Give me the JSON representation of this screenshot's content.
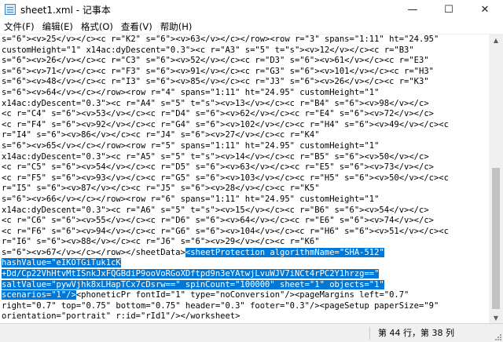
{
  "window": {
    "title": "sheet1.xml - 记事本",
    "icon": "notepad-icon",
    "controls": {
      "minimize": "—",
      "maximize": "☐",
      "close": "✕"
    }
  },
  "menu": {
    "items": [
      {
        "label": "文件(F)"
      },
      {
        "label": "编辑(E)"
      },
      {
        "label": "格式(O)"
      },
      {
        "label": "查看(V)"
      },
      {
        "label": "帮助(H)"
      }
    ]
  },
  "editor": {
    "lines": [
      {
        "text": "s=\"6\"><v>25</v></c><c r=\"K2\" s=\"6\"><v>63</v></c></row><row r=\"3\" spans=\"1:11\" ht=\"24.95\""
      },
      {
        "text": "customHeight=\"1\" x14ac:dyDescent=\"0.3\"><c r=\"A3\" s=\"5\" t=\"s\"><v>12</v></c><c r=\"B3\""
      },
      {
        "text": "s=\"6\"><v>26</v></c><c r=\"C3\" s=\"6\"><v>52</v></c><c r=\"D3\" s=\"6\"><v>61</v></c><c r=\"E3\""
      },
      {
        "text": "s=\"6\"><v>71</v></c><c r=\"F3\" s=\"6\"><v>91</v></c><c r=\"G3\" s=\"6\"><v>101</v></c><c r=\"H3\""
      },
      {
        "text": "s=\"6\"><v>48</v></c><c r=\"I3\" s=\"6\"><v>85</v></c><c r=\"J3\" s=\"6\"><v>26</v></c><c r=\"K3\""
      },
      {
        "text": "s=\"6\"><v>64</v></c></row><row r=\"4\" spans=\"1:11\" ht=\"24.95\" customHeight=\"1\""
      },
      {
        "text": "x14ac:dyDescent=\"0.3\"><c r=\"A4\" s=\"5\" t=\"s\"><v>13</v></c><c r=\"B4\" s=\"6\"><v>98</v></c>"
      },
      {
        "text": "<c r=\"C4\" s=\"6\"><v>53</v></c><c r=\"D4\" s=\"6\"><v>62</v></c><c r=\"E4\" s=\"6\"><v>72</v></c>"
      },
      {
        "text": "<c r=\"F4\" s=\"6\"><v>92</v></c><c r=\"G4\" s=\"6\"><v>102</v></c><c r=\"H4\" s=\"6\"><v>49</v></c><c"
      },
      {
        "text": "r=\"I4\" s=\"6\"><v>86</v></c><c r=\"J4\" s=\"6\"><v>27</v></c><c r=\"K4\""
      },
      {
        "text": "s=\"6\"><v>65</v></c></row><row r=\"5\" spans=\"1:11\" ht=\"24.95\" customHeight=\"1\""
      },
      {
        "text": "x14ac:dyDescent=\"0.3\"><c r=\"A5\" s=\"5\" t=\"s\"><v>14</v></c><c r=\"B5\" s=\"6\"><v>50</v></c>"
      },
      {
        "text": "<c r=\"C5\" s=\"6\"><v>54</v></c><c r=\"D5\" s=\"6\"><v>63</v></c><c r=\"E5\" s=\"6\"><v>73</v></c>"
      },
      {
        "text": "<c r=\"F5\" s=\"6\"><v>93</v></c><c r=\"G5\" s=\"6\"><v>103</v></c><c r=\"H5\" s=\"6\"><v>50</v></c><c"
      },
      {
        "text": "r=\"I5\" s=\"6\"><v>87</v></c><c r=\"J5\" s=\"6\"><v>28</v></c><c r=\"K5\""
      },
      {
        "text": "s=\"6\"><v>66</v></c></row><row r=\"6\" spans=\"1:11\" ht=\"24.95\" customHeight=\"1\""
      },
      {
        "text": "x14ac:dyDescent=\"0.3\"><c r=\"A6\" s=\"5\" t=\"s\"><v>15</v></c><c r=\"B6\" s=\"6\"><v>54</v></c>"
      },
      {
        "text": "<c r=\"C6\" s=\"6\"><v>55</v></c><c r=\"D6\" s=\"6\"><v>64</v></c><c r=\"E6\" s=\"6\"><v>74</v></c>"
      },
      {
        "text": "<c r=\"F6\" s=\"6\"><v>94</v></c><c r=\"G6\" s=\"6\"><v>104</v></c><c r=\"H6\" s=\"6\"><v>51</v></c><c"
      },
      {
        "text": "r=\"I6\" s=\"6\"><v>88</v></c><c r=\"J6\" s=\"6\"><v>29</v></c><c r=\"K6\""
      },
      {
        "text": "s=\"6\"><v>67</v></c></row></sheetData>",
        "selected": "<sheetProtection algorithmName=\"SHA-512\""
      },
      {
        "text": "",
        "selected": "hashValue=\"eIKOTGiTuk1cK"
      },
      {
        "text": "",
        "selected": "+Dd/Cp22VhHtvMtISnkJxFQGBdiP9ooVoRGoXDftpd9n3eYAtwjLvuWJV7iNCt4rPC2Y1hrzg==\""
      },
      {
        "text": "",
        "selected": "saltValue=\"pywVjhk8xLHapTCx7cDsrw==\" spinCount=\"100000\" sheet=\"1\" objects=\"1\""
      },
      {
        "text": "",
        "selected": "scenarios=\"1\"/>",
        "after": "<phoneticPr fontId=\"1\" type=\"noConversion\"/><pageMargins left=\"0.7\""
      },
      {
        "text": "right=\"0.7\" top=\"0.75\" bottom=\"0.75\" header=\"0.3\" footer=\"0.3\"/><pageSetup paperSize=\"9\""
      },
      {
        "text": "orientation=\"portrait\" r:id=\"rId1\"/></worksheet>"
      }
    ]
  },
  "status": {
    "position": "第 44 行，第 38 列"
  },
  "colors": {
    "selection": "#0078d7",
    "statusbar": "#f0f0f0"
  }
}
